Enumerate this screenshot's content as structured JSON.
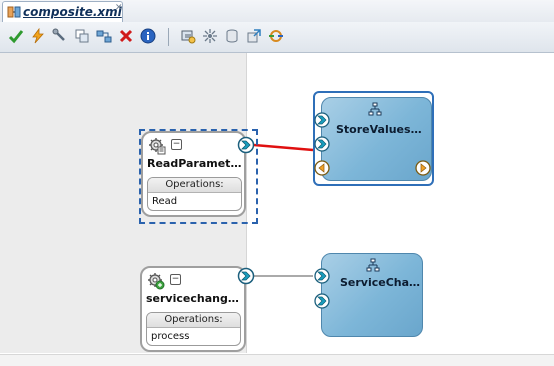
{
  "tab": {
    "title": "composite.xml"
  },
  "toolbar": {
    "icons": [
      "validate-icon",
      "deploy-icon",
      "wrench-icon",
      "create-icon",
      "wire-icon",
      "delete-icon",
      "info-icon",
      "refresh-icon",
      "layout-icon",
      "database-icon",
      "export-icon",
      "ring-icon"
    ]
  },
  "services": [
    {
      "name": "ReadParamet…",
      "ops_header": "Operations:",
      "ops": [
        "Read"
      ],
      "selected": true
    },
    {
      "name": "servicechang…",
      "ops_header": "Operations:",
      "ops": [
        "process"
      ],
      "selected": false
    }
  ],
  "components": [
    {
      "name": "StoreValues…",
      "selected": true
    },
    {
      "name": "ServiceCha…",
      "selected": false
    }
  ],
  "colors": {
    "wire_selected": "#e01010",
    "wire_default": "#8d8d8d",
    "selection": "#2a62ad",
    "component_fill": "#7db6d8"
  }
}
